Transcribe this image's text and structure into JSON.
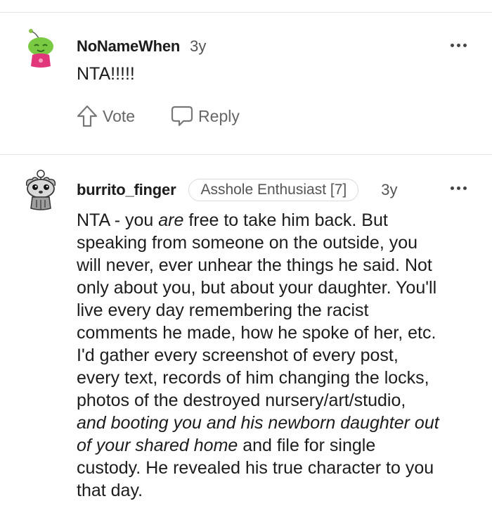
{
  "comments": [
    {
      "username": "NoNameWhen",
      "time": "3y",
      "body": "NTA!!!!!",
      "vote_label": "Vote",
      "reply_label": "Reply",
      "avatar": "snoo-green-avatar-icon"
    },
    {
      "username": "burrito_finger",
      "flair": "Asshole Enthusiast [7]",
      "time": "3y",
      "avatar": "snoo-cartoon-avatar-icon",
      "body_lines": [
        [
          "NTA - you ",
          "are",
          " free to take him back. But"
        ],
        "speaking from someone on the outside, you",
        "will never, ever unhear the things he said. Not",
        "only about you, but about your daughter. You'll",
        "live every day remembering the racist",
        "comments he made, how he spoke of her, etc.",
        "I'd gather every screenshot of every post,",
        "every text, records of him changing the locks,",
        "photos of the destroyed nursery/art/studio,",
        "and booting you and his newborn daughter out",
        [
          "of your shared home",
          " and file for single"
        ],
        "custody. He revealed his true character to you",
        "that day."
      ]
    }
  ]
}
